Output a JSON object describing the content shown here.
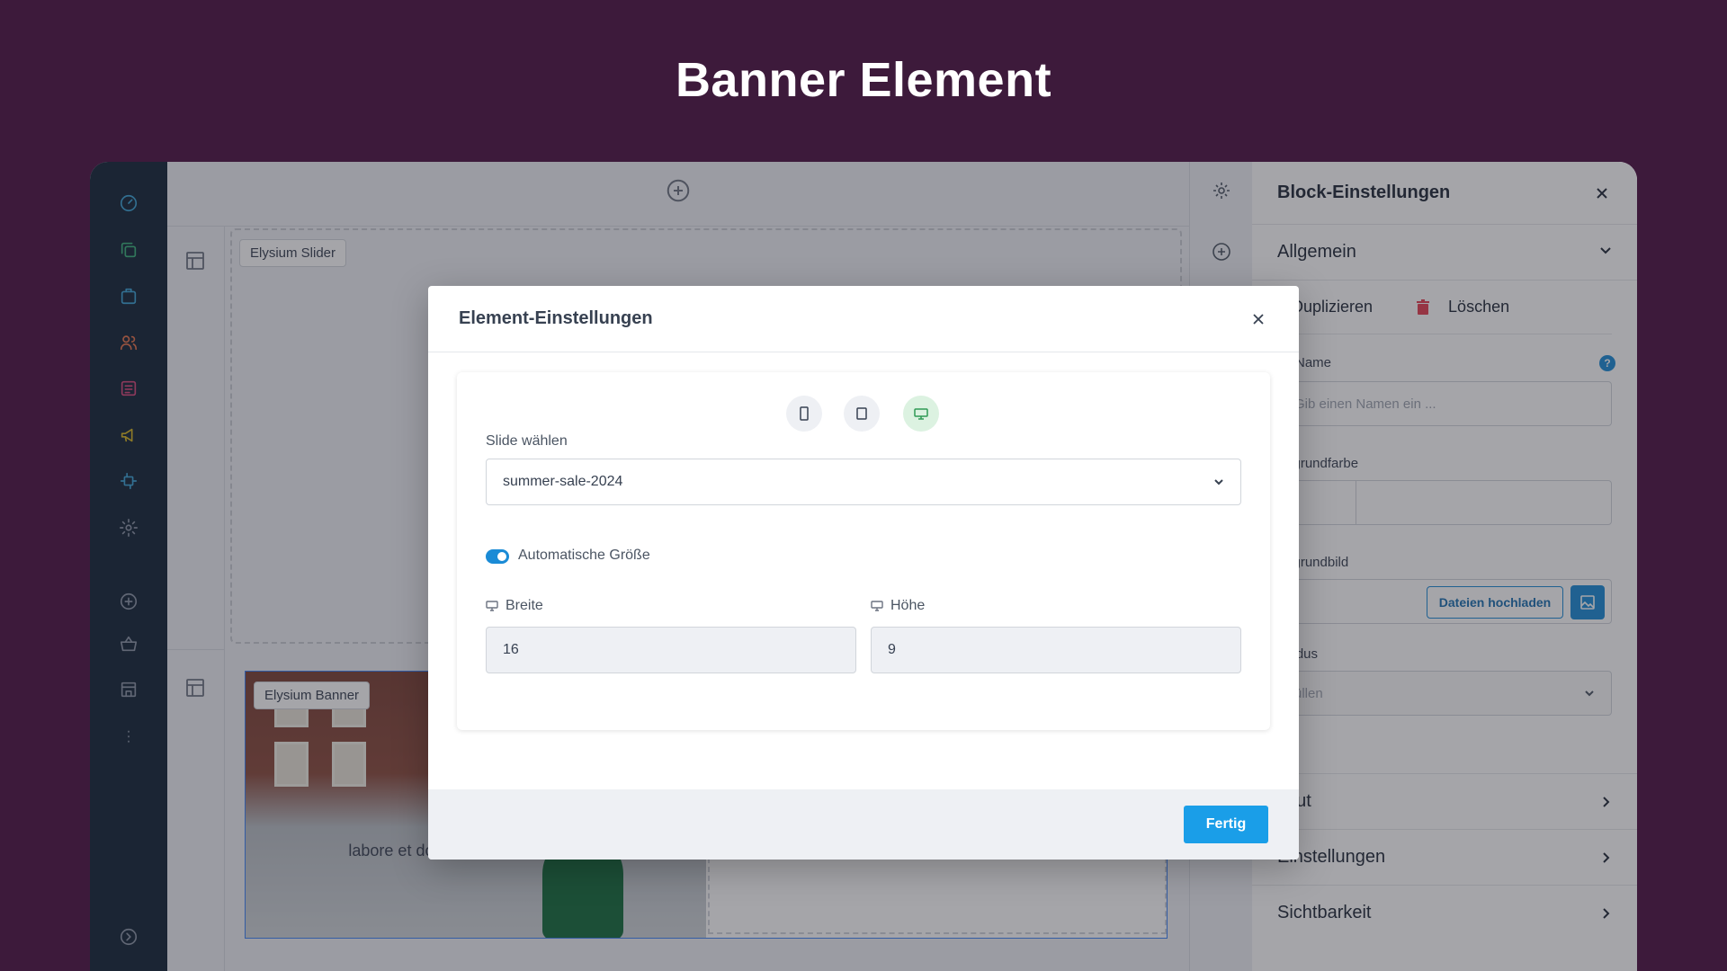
{
  "hero": {
    "title": "Banner Element"
  },
  "sidebar": {
    "items": [
      {
        "icon": "dashboard-icon",
        "color": "#3aa3d6"
      },
      {
        "icon": "copy-icon",
        "color": "#38b27a"
      },
      {
        "icon": "bag-icon",
        "color": "#3aa3d6"
      },
      {
        "icon": "users-icon",
        "color": "#e8734a"
      },
      {
        "icon": "list-icon",
        "color": "#d8457a"
      },
      {
        "icon": "megaphone-icon",
        "color": "#d6b51f"
      },
      {
        "icon": "plugin-icon",
        "color": "#3aa3d6"
      },
      {
        "icon": "gear-icon",
        "color": "#8a94a6"
      },
      {
        "icon": "add-icon",
        "color": "#8a94a6"
      },
      {
        "icon": "basket-icon",
        "color": "#8a94a6"
      },
      {
        "icon": "store-icon",
        "color": "#8a94a6"
      },
      {
        "icon": "more-icon",
        "color": "#8a94a6"
      },
      {
        "icon": "expand-icon",
        "color": "#8a94a6"
      }
    ]
  },
  "canvas": {
    "slider_label": "Elysium Slider",
    "banner_label": "Elysium Banner",
    "banner_text": "labore et dolore magna aliq... voluptua."
  },
  "settings": {
    "title": "Block-Einstellungen",
    "section_general": "Allgemein",
    "duplicate": "Duplizieren",
    "delete": "Löschen",
    "block_name_label": "ck-Name",
    "block_name_placeholder": "Gib einen Namen ein ...",
    "bg_color_label": "tergrundfarbe",
    "bg_image_label": "tergrundbild",
    "upload_label": "Dateien hochladen",
    "mode_label": "modus",
    "mode_value": "üllen",
    "section_layout": "yout",
    "section_settings": "Einstellungen",
    "section_visibility": "Sichtbarkeit"
  },
  "modal": {
    "title": "Element-Einstellungen",
    "slide_label": "Slide wählen",
    "slide_value": "summer-sale-2024",
    "auto_size_label": "Automatische Größe",
    "width_label": "Breite",
    "width_value": "16",
    "height_label": "Höhe",
    "height_value": "9",
    "done_label": "Fertig"
  },
  "colors": {
    "background": "#3d1a3b",
    "accent": "#1a9ee8",
    "sidebar": "#122436"
  }
}
